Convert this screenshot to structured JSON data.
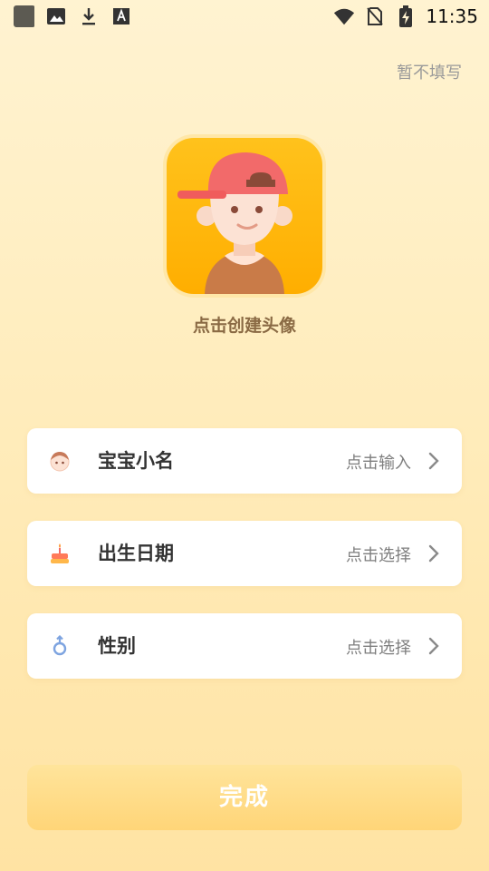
{
  "status_bar": {
    "time": "11:35",
    "left_icons": [
      "app-square-icon",
      "image-icon",
      "download-icon",
      "font-icon"
    ],
    "right_icons": [
      "wifi-icon",
      "no-sim-icon",
      "battery-charging-icon"
    ]
  },
  "skip_label": "暂不填写",
  "avatar": {
    "caption": "点击创建头像"
  },
  "fields": [
    {
      "label": "宝宝小名",
      "hint": "点击输入",
      "icon": "baby-face-icon"
    },
    {
      "label": "出生日期",
      "hint": "点击选择",
      "icon": "birthday-cake-icon"
    },
    {
      "label": "性别",
      "hint": "点击选择",
      "icon": "gender-icon"
    }
  ],
  "done_label": "完成",
  "colors": {
    "accent": "#FFB300",
    "button": "#FFD578",
    "background": "#FFF0C8"
  }
}
